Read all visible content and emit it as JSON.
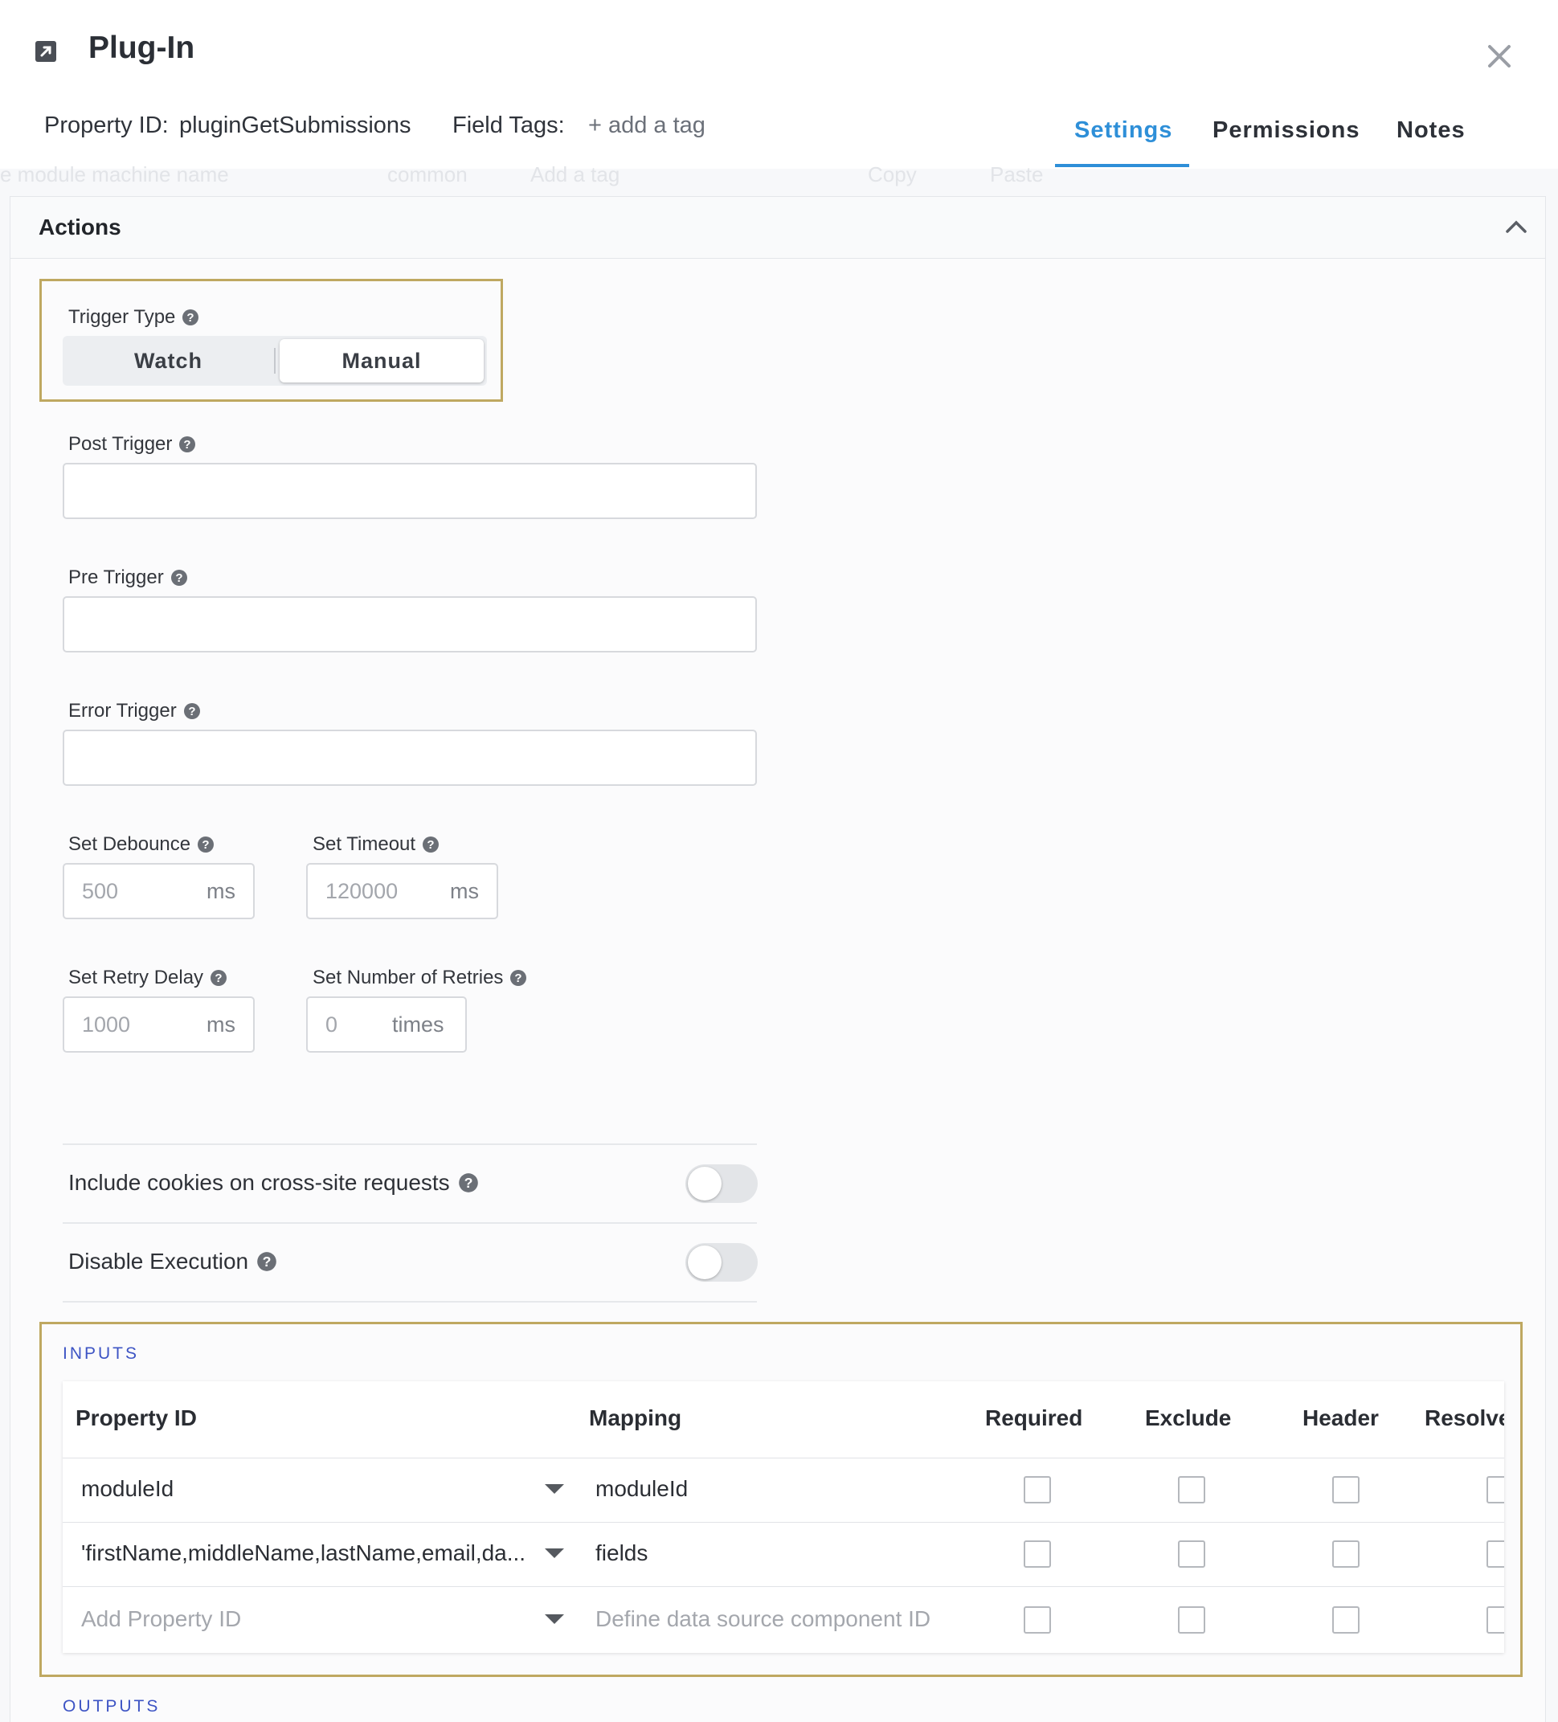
{
  "header": {
    "title": "Plug-In",
    "property_id_label": "Property ID:",
    "property_id_value": "pluginGetSubmissions",
    "field_tags_label": "Field Tags:",
    "add_tag": "+ add a tag",
    "tabs": [
      {
        "label": "Settings",
        "active": true
      },
      {
        "label": "Permissions",
        "active": false
      },
      {
        "label": "Notes",
        "active": false
      }
    ]
  },
  "background_ghost": {
    "machine_name": "e module machine name",
    "tag": "common",
    "add_tag": "Add a tag",
    "copy": "Copy",
    "paste": "Paste"
  },
  "actions": {
    "title": "Actions",
    "trigger_type": {
      "label": "Trigger Type",
      "options": [
        "Watch",
        "Manual"
      ],
      "selected": "Manual"
    },
    "post_trigger": {
      "label": "Post Trigger",
      "value": ""
    },
    "pre_trigger": {
      "label": "Pre Trigger",
      "value": ""
    },
    "error_trigger": {
      "label": "Error Trigger",
      "value": ""
    },
    "debounce": {
      "label": "Set Debounce",
      "value": "500",
      "unit": "ms"
    },
    "timeout": {
      "label": "Set Timeout",
      "value": "120000",
      "unit": "ms"
    },
    "retry_delay": {
      "label": "Set Retry Delay",
      "value": "1000",
      "unit": "ms"
    },
    "retries": {
      "label": "Set Number of Retries",
      "value": "0",
      "unit": "times"
    },
    "include_cookies": {
      "label": "Include cookies on cross-site requests",
      "on": false
    },
    "disable_execution": {
      "label": "Disable Execution",
      "on": false
    }
  },
  "inputs": {
    "section_label": "INPUTS",
    "columns": [
      "Property ID",
      "Mapping",
      "Required",
      "Exclude",
      "Header",
      "Resolve"
    ],
    "rows": [
      {
        "property_id": "moduleId",
        "mapping": "moduleId"
      },
      {
        "property_id": "'firstName,middleName,lastName,email,da...",
        "mapping": "fields"
      }
    ],
    "add_row": {
      "property_placeholder": "Add Property ID",
      "mapping_placeholder": "Define data source component ID"
    }
  },
  "outputs": {
    "section_label": "OUTPUTS"
  },
  "colors": {
    "accent": "#2e8fd8",
    "highlight_border": "#bfa861",
    "section_label": "#3d54c4"
  }
}
